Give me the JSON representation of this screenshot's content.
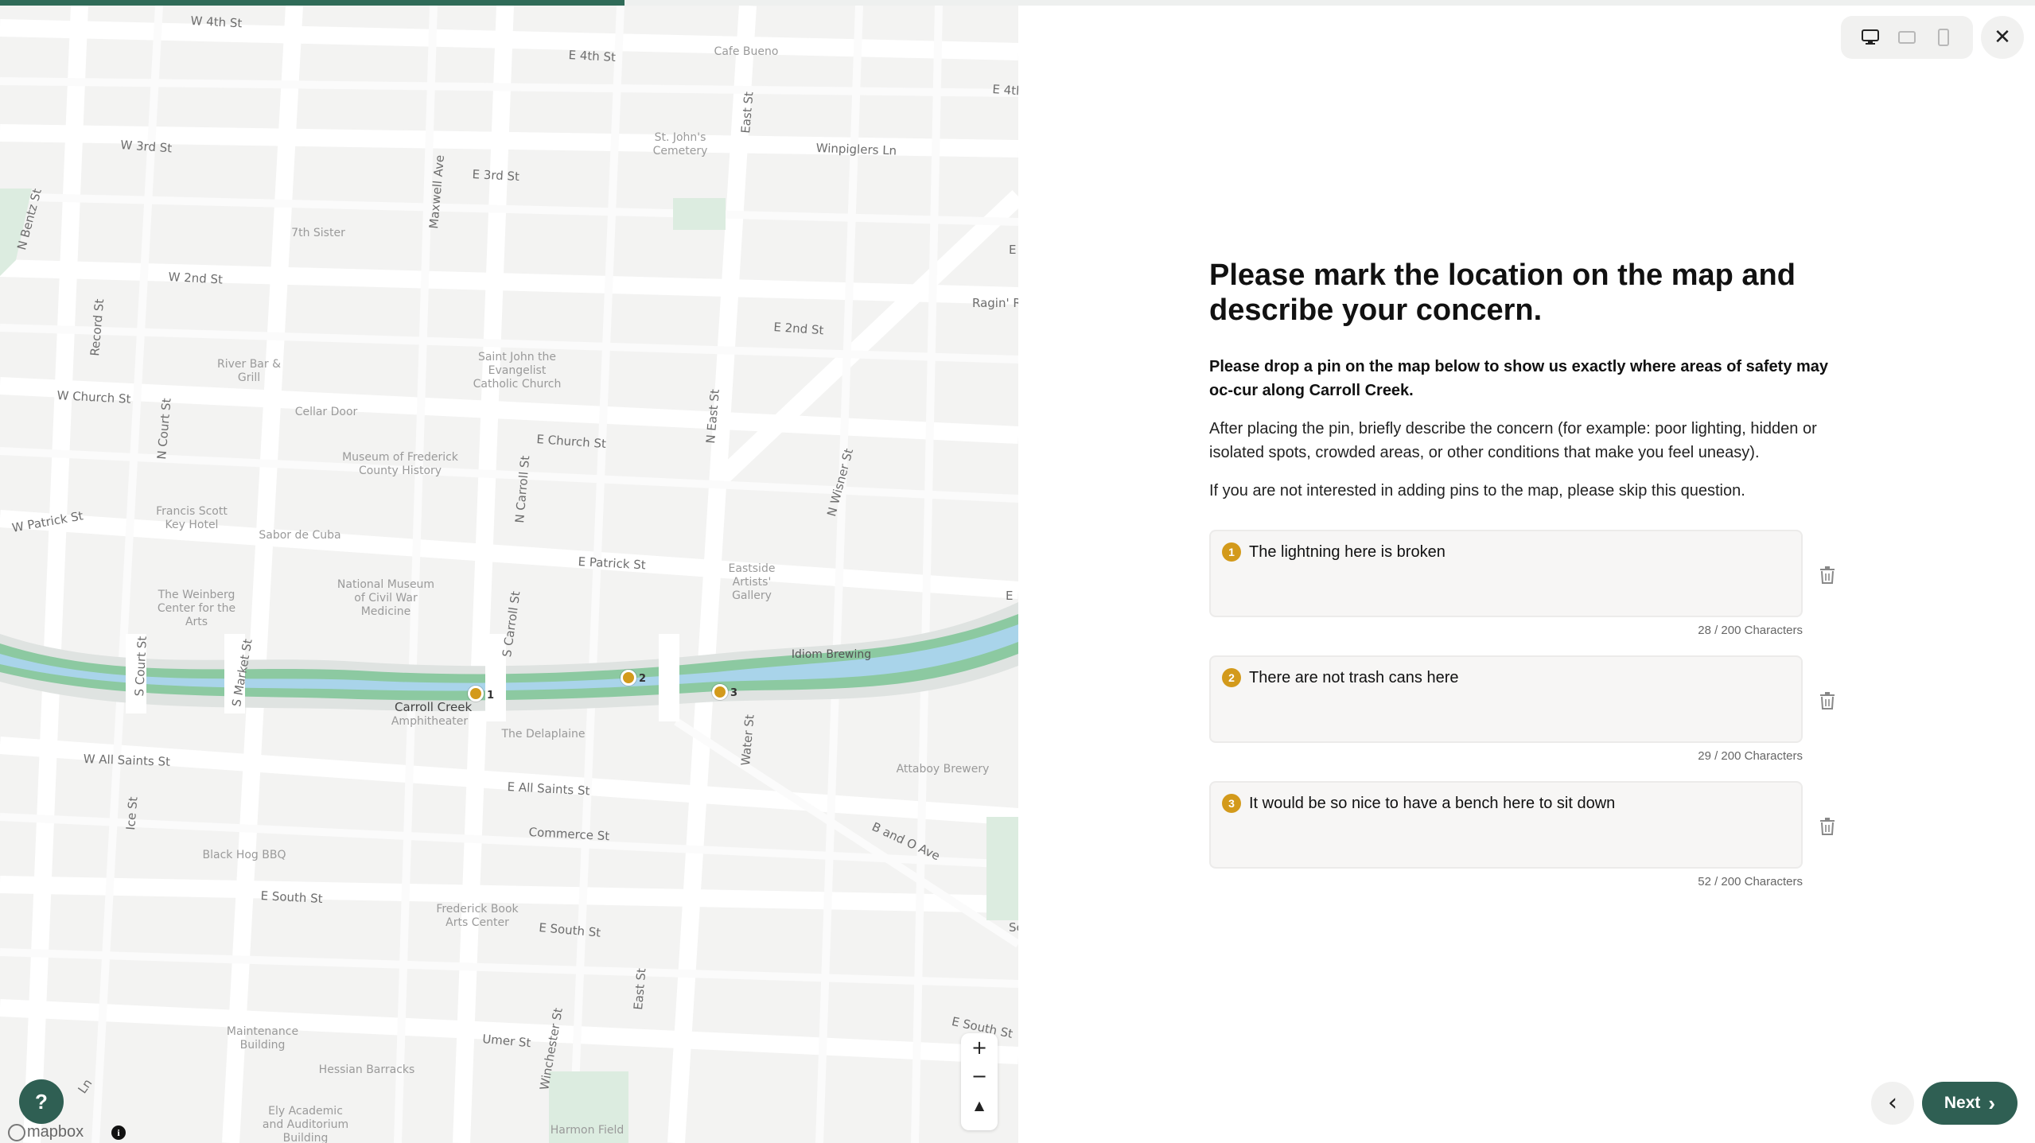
{
  "progress": {
    "fraction": 0.307
  },
  "map": {
    "streets": [
      {
        "id": "w4th",
        "text": "W 4th St"
      },
      {
        "id": "e4th",
        "text": "E 4th St"
      },
      {
        "id": "e4th2",
        "text": "E 4th"
      },
      {
        "id": "w3rd",
        "text": "W 3rd St"
      },
      {
        "id": "e3rd",
        "text": "E 3rd St"
      },
      {
        "id": "winpiglers",
        "text": "Winpiglers Ln"
      },
      {
        "id": "w2nd",
        "text": "W 2nd St"
      },
      {
        "id": "e2nd",
        "text": "E 2nd St"
      },
      {
        "id": "wchurch",
        "text": "W Church St"
      },
      {
        "id": "echurch",
        "text": "E Church St"
      },
      {
        "id": "wpatrick",
        "text": "W Patrick St"
      },
      {
        "id": "epatrick",
        "text": "E Patrick St"
      },
      {
        "id": "wallsaints",
        "text": "W All Saints St"
      },
      {
        "id": "eallsaints",
        "text": "E All Saints St"
      },
      {
        "id": "commerce",
        "text": "Commerce St"
      },
      {
        "id": "bando",
        "text": "B and O Ave"
      },
      {
        "id": "esouth",
        "text": "E South St"
      },
      {
        "id": "esouth2",
        "text": "E South St"
      },
      {
        "id": "esouth3",
        "text": "E South St"
      },
      {
        "id": "umer",
        "text": "Umer St"
      },
      {
        "id": "nbentz",
        "text": "N Bentz St"
      },
      {
        "id": "record",
        "text": "Record St"
      },
      {
        "id": "maxwell",
        "text": "Maxwell Ave"
      },
      {
        "id": "eastst",
        "text": "East St"
      },
      {
        "id": "neast",
        "text": "N East St"
      },
      {
        "id": "ncourt",
        "text": "N Court St"
      },
      {
        "id": "ncarroll",
        "text": "N Carroll St"
      },
      {
        "id": "nwisner",
        "text": "N Wisner St"
      },
      {
        "id": "scourt",
        "text": "S Court St"
      },
      {
        "id": "smarket",
        "text": "S Market St"
      },
      {
        "id": "scarroll",
        "text": "S Carroll St"
      },
      {
        "id": "water",
        "text": "Water St"
      },
      {
        "id": "ice",
        "text": "Ice St"
      },
      {
        "id": "eastst2",
        "text": "East St"
      },
      {
        "id": "winchester",
        "text": "Winchester St"
      },
      {
        "id": "raginred",
        "text": "Ragin' Re"
      },
      {
        "id": "ee",
        "text": "E"
      },
      {
        "id": "ee2",
        "text": "E"
      },
      {
        "id": "ln",
        "text": "Ln"
      },
      {
        "id": "sc",
        "text": "Sc"
      }
    ],
    "pois": [
      {
        "id": "cafebueno",
        "text": "Cafe Bueno"
      },
      {
        "id": "stjohns",
        "text": "St. John's Cemetery"
      },
      {
        "id": "7thsister",
        "text": "7th Sister"
      },
      {
        "id": "riverbar",
        "text": "River Bar & Grill"
      },
      {
        "id": "stjohnchurch",
        "text": "Saint John the Evangelist Catholic Church"
      },
      {
        "id": "cellardoor",
        "text": "Cellar Door"
      },
      {
        "id": "museum",
        "text": "Museum of Frederick County History"
      },
      {
        "id": "francisscott",
        "text": "Francis Scott Key Hotel"
      },
      {
        "id": "sabor",
        "text": "Sabor de Cuba"
      },
      {
        "id": "weinberg",
        "text": "The Weinberg Center for the Arts"
      },
      {
        "id": "civilwar",
        "text": "National Museum of Civil War Medicine"
      },
      {
        "id": "eastside",
        "text": "Eastside Artists' Gallery"
      },
      {
        "id": "idiom",
        "text": "Idiom Brewing"
      },
      {
        "id": "amphitheater",
        "text": "Amphitheater"
      },
      {
        "id": "delaplaine",
        "text": "The Delaplaine"
      },
      {
        "id": "attaboy",
        "text": "Attaboy Brewery"
      },
      {
        "id": "blackhog",
        "text": "Black Hog BBQ"
      },
      {
        "id": "frederickbook",
        "text": "Frederick Book Arts Center"
      },
      {
        "id": "maintenance",
        "text": "Maintenance Building"
      },
      {
        "id": "hessian",
        "text": "Hessian Barracks"
      },
      {
        "id": "elyacademic",
        "text": "Ely Academic and Auditorium Building"
      },
      {
        "id": "harmonfield",
        "text": "Harmon Field"
      }
    ],
    "creek_label": "Carroll Creek",
    "pins": [
      {
        "number": "1"
      },
      {
        "number": "2"
      },
      {
        "number": "3"
      }
    ],
    "zoom_in": "+",
    "zoom_out": "−",
    "compass": "▲",
    "attribution": "mapbox",
    "info": "i"
  },
  "help_label": "?",
  "close_label": "✕",
  "devices": [
    {
      "name": "desktop-icon",
      "active": true
    },
    {
      "name": "tablet-icon",
      "active": false
    },
    {
      "name": "mobile-icon",
      "active": false
    }
  ],
  "question": {
    "title": "Please mark the location on the map and describe your concern.",
    "intro_bold": "Please drop a pin on the map below to show us exactly where areas of safety may oc-cur along Carroll Creek.",
    "paragraph1": "After placing the pin, briefly describe the concern (for example: poor lighting, hidden or isolated spots, crowded areas, or other conditions that make you feel uneasy).",
    "paragraph2": "If you are not interested in adding pins to the map, please skip this question."
  },
  "entries": [
    {
      "number": "1",
      "text": "The lightning here is broken",
      "count": "28 / 200 Characters"
    },
    {
      "number": "2",
      "text": "There are not trash cans here",
      "count": "29 / 200 Characters"
    },
    {
      "number": "3",
      "text": "It would be so nice to have a bench here to sit down",
      "count": "52 / 200 Characters"
    }
  ],
  "nav": {
    "back_icon": "‹",
    "next_label": "Next",
    "next_icon": "›"
  },
  "colors": {
    "accent": "#2f5f53",
    "progress": "#2f6b58",
    "pin": "#d39a1b",
    "creek_water": "#a9d4ea",
    "creek_park": "#8cc9a1"
  }
}
